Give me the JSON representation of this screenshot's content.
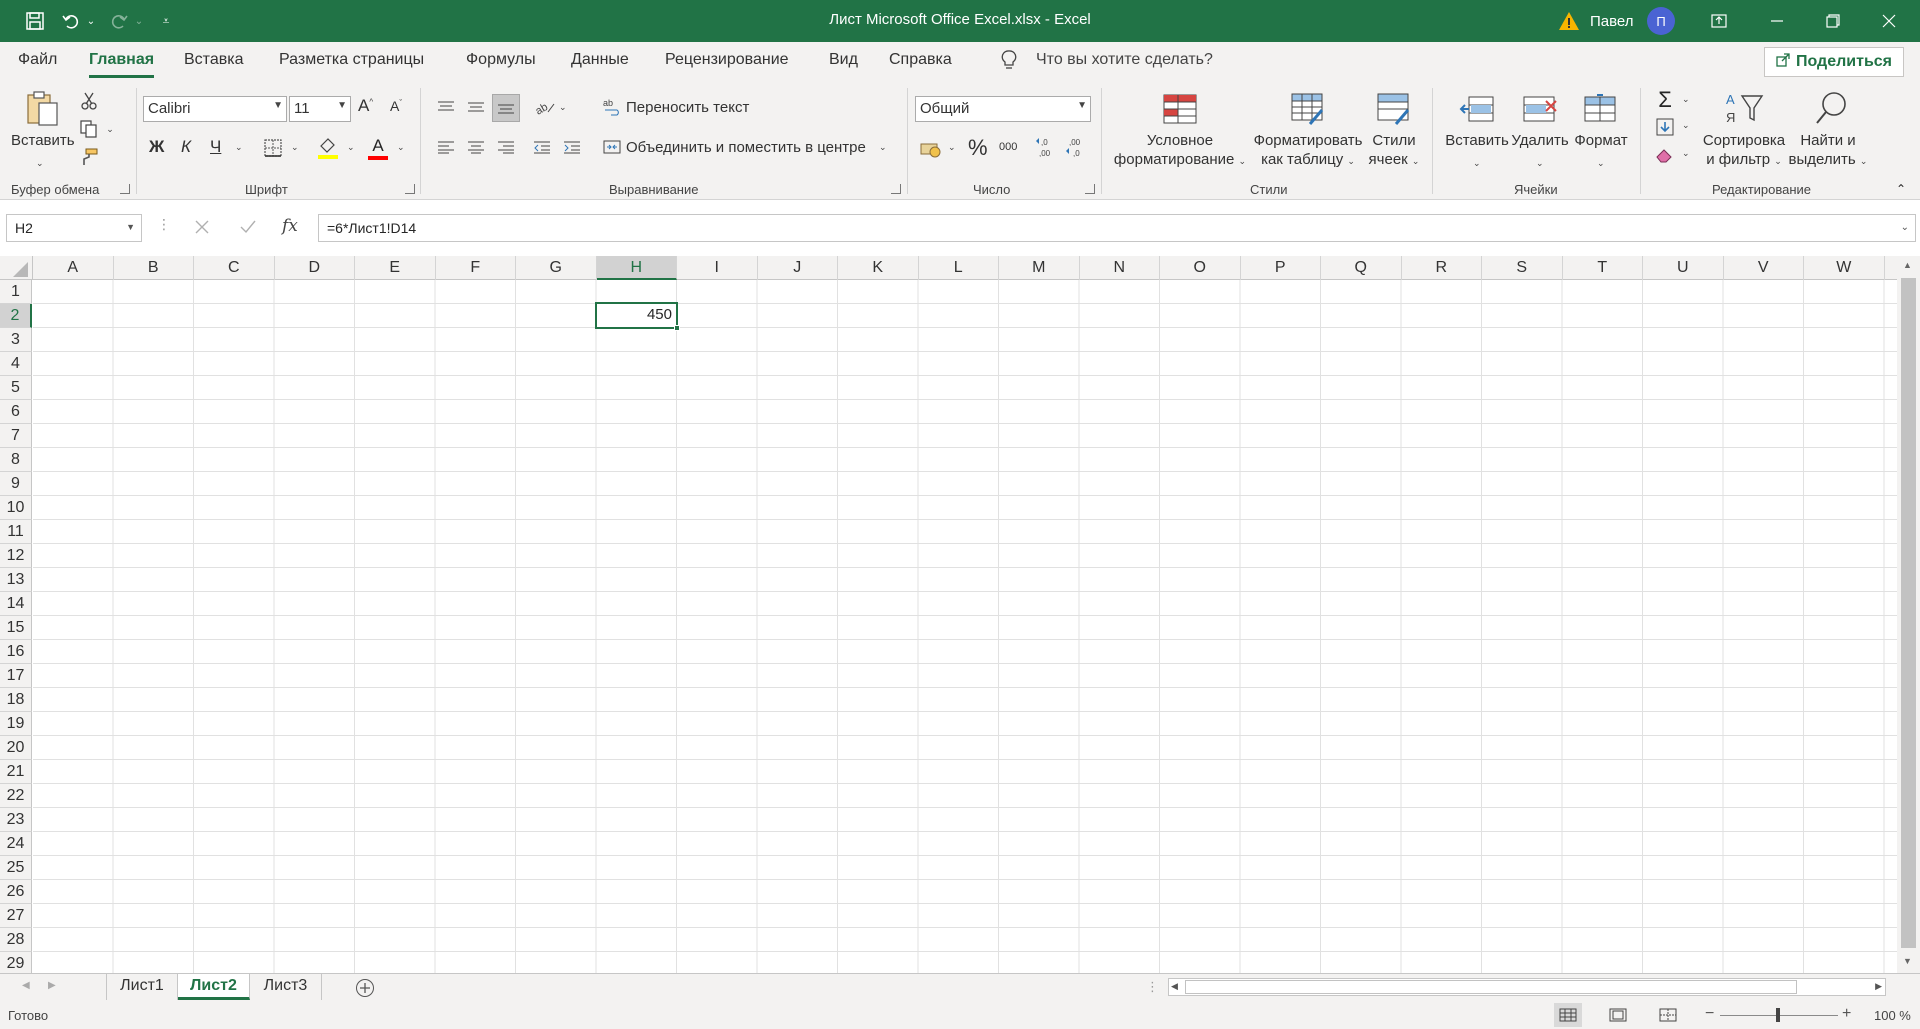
{
  "window": {
    "title": "Лист Microsoft Office Excel.xlsx  -  Excel",
    "user_name": "Павел",
    "user_initial": "П"
  },
  "menu": {
    "tabs": [
      "Файл",
      "Главная",
      "Вставка",
      "Разметка страницы",
      "Формулы",
      "Данные",
      "Рецензирование",
      "Вид",
      "Справка"
    ],
    "active_tab": "Главная",
    "tell_me": "Что вы хотите сделать?",
    "share": "Поделиться"
  },
  "ribbon": {
    "clipboard": {
      "paste": "Вставить",
      "label": "Буфер обмена"
    },
    "font": {
      "name": "Calibri",
      "size": "11",
      "bold": "Ж",
      "italic": "К",
      "underline": "Ч",
      "grow": "A",
      "shrink": "A",
      "color_letter": "A",
      "label": "Шрифт"
    },
    "alignment": {
      "wrap": "Переносить текст",
      "merge": "Объединить и поместить в центре",
      "label": "Выравнивание"
    },
    "number": {
      "format": "Общий",
      "percent": "%",
      "thousands": "000",
      "label": "Число"
    },
    "styles": {
      "conditional_1": "Условное",
      "conditional_2": "форматирование",
      "table_1": "Форматировать",
      "table_2": "как таблицу",
      "cell_1": "Стили",
      "cell_2": "ячеек",
      "label": "Стили"
    },
    "cells": {
      "insert": "Вставить",
      "delete": "Удалить",
      "format": "Формат",
      "label": "Ячейки"
    },
    "editing": {
      "sort_1": "Сортировка",
      "sort_2": "и фильтр",
      "find_1": "Найти и",
      "find_2": "выделить",
      "label": "Редактирование"
    }
  },
  "formula_bar": {
    "name_box": "H2",
    "fx": "fx",
    "formula": "=6*Лист1!D14"
  },
  "grid": {
    "columns": [
      "A",
      "B",
      "C",
      "D",
      "E",
      "F",
      "G",
      "H",
      "I",
      "J",
      "K",
      "L",
      "M",
      "N",
      "O",
      "P",
      "Q",
      "R",
      "S",
      "T",
      "U",
      "V",
      "W"
    ],
    "rows": [
      "1",
      "2",
      "3",
      "4",
      "5",
      "6",
      "7",
      "8",
      "9",
      "10",
      "11",
      "12",
      "13",
      "14",
      "15",
      "16",
      "17",
      "18",
      "19",
      "20",
      "21",
      "22",
      "23",
      "24",
      "25",
      "26",
      "27",
      "28",
      "29"
    ],
    "selected_column": "H",
    "selected_row": "2",
    "cell_value": "450"
  },
  "sheets": {
    "tabs": [
      "Лист1",
      "Лист2",
      "Лист3"
    ],
    "active": "Лист2"
  },
  "status": {
    "ready": "Готово",
    "zoom": "100 %"
  },
  "colors": {
    "accent": "#217346",
    "ribbon_bg": "#f3f2f1",
    "avatar": "#4a63d3"
  }
}
